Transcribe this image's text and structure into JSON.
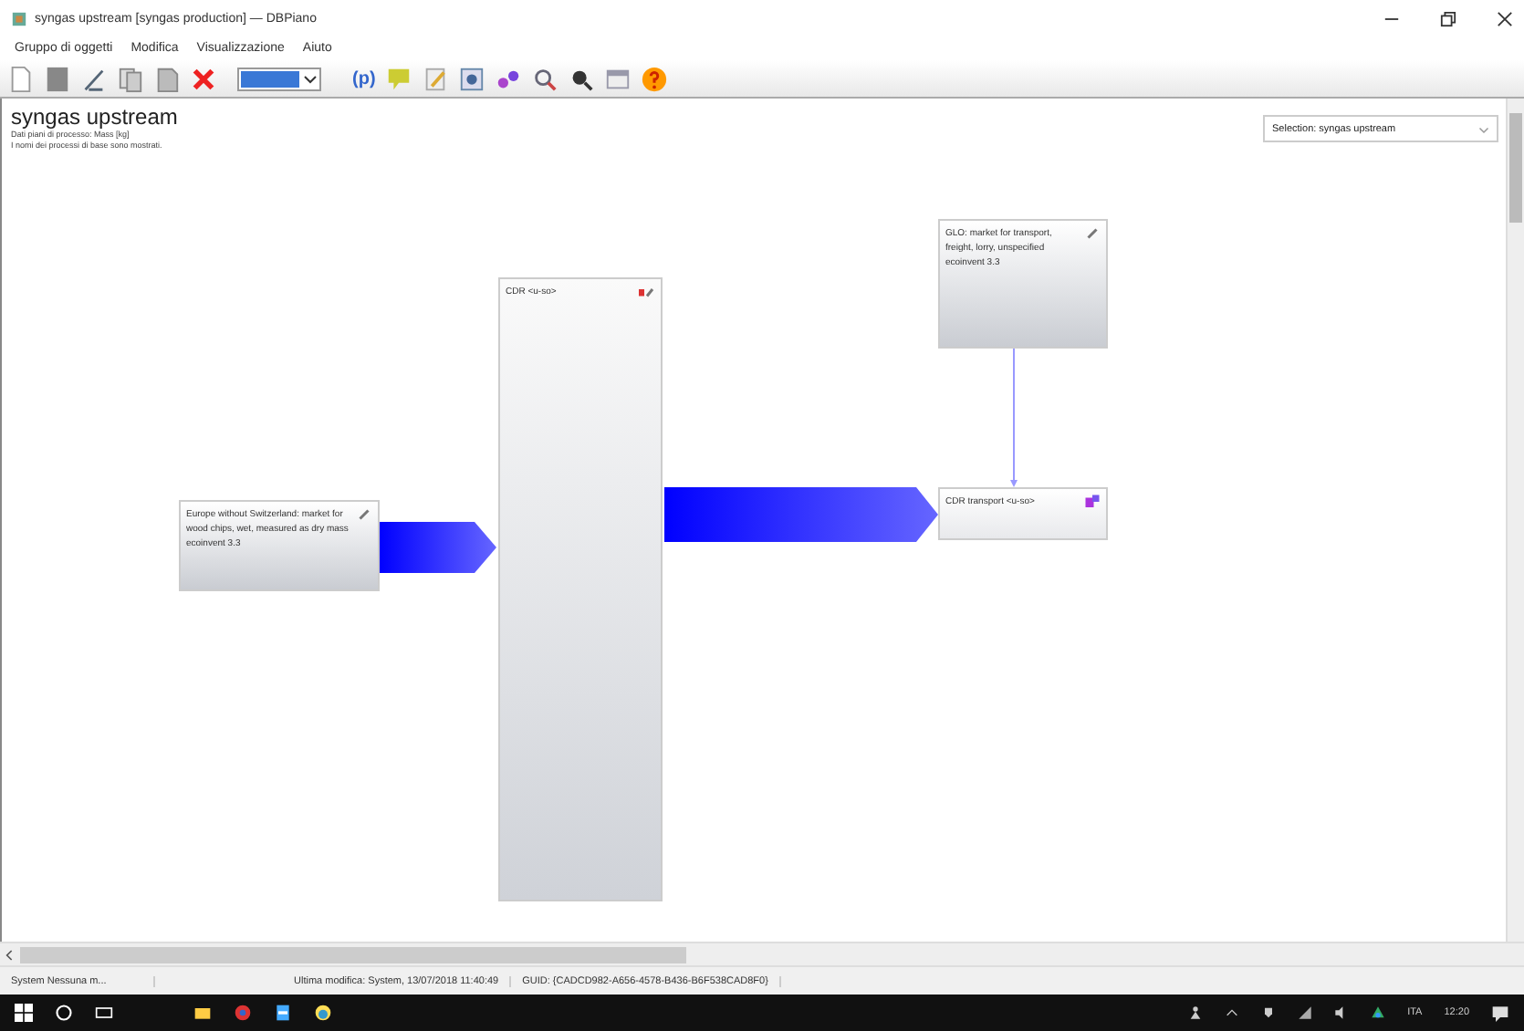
{
  "window": {
    "title": "syngas upstream [syngas production] — DBPiano"
  },
  "menu": [
    "Gruppo di oggetti",
    "Modifica",
    "Visualizzazione",
    "Aiuto"
  ],
  "toolbar": {
    "param_label": "(p)"
  },
  "canvas": {
    "heading": "syngas upstream",
    "subtitle_lines": [
      "Dati piani di processo: Mass [kg]",
      "I nomi dei processi di base sono mostrati."
    ],
    "selection": "Selection: syngas upstream",
    "nodes": [
      {
        "label": "Europe without Switzerland: market for wood chips, wet, measured as dry mass ecoinvent 3.3",
        "kind": "input"
      },
      {
        "label": "CDR <u-so>",
        "kind": "main"
      },
      {
        "label": "GLO: market for transport, freight, lorry, unspecified ecoinvent 3.3",
        "kind": "input"
      },
      {
        "label": "CDR transport <u-so>",
        "kind": "output"
      }
    ]
  },
  "status_bar": [
    "System Nessuna m...",
    "Ultima modifica: System, 13/07/2018 11:40:49",
    "GUID: {CADCD982-A656-4578-B436-B6F538CAD8F0}"
  ],
  "taskbar": {
    "language": "ITA",
    "time": "12:20"
  }
}
